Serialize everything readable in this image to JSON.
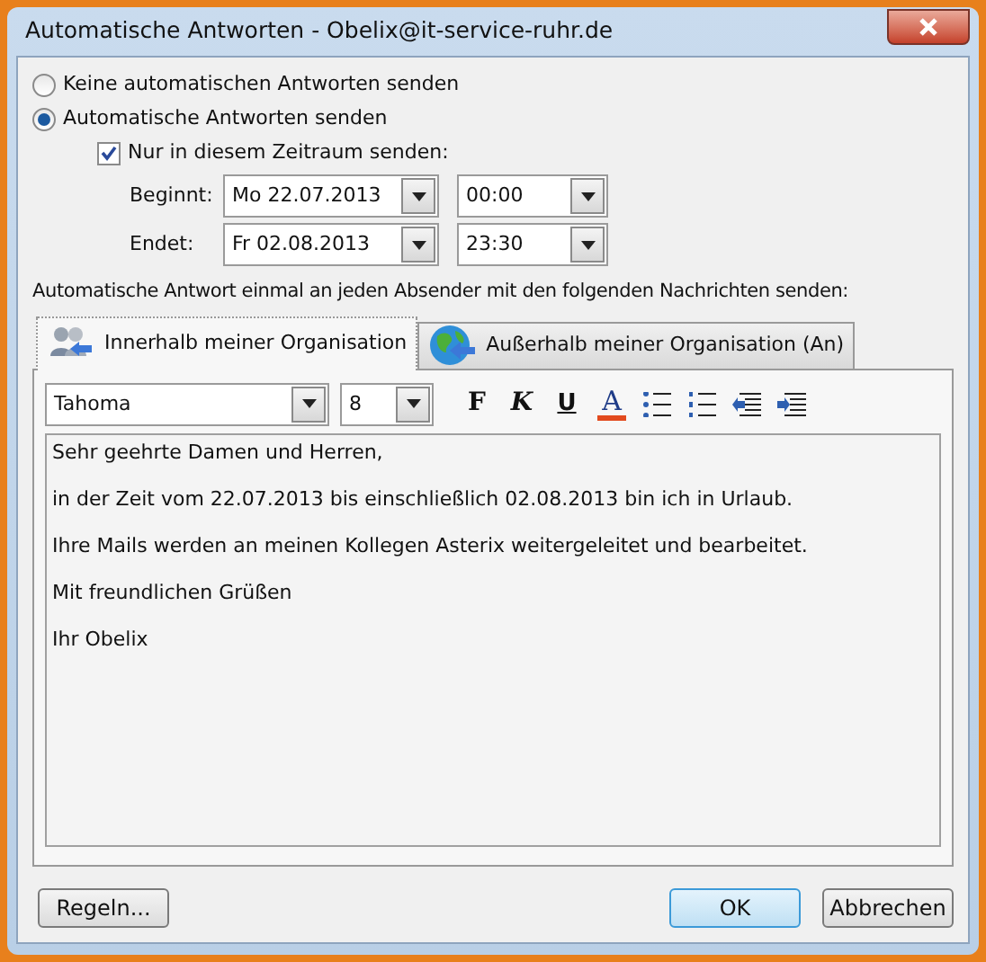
{
  "window": {
    "title": "Automatische Antworten - Obelix@it-service-ruhr.de"
  },
  "mode_options": [
    {
      "label": "Keine automatischen Antworten senden",
      "selected": false
    },
    {
      "label": "Automatische Antworten senden",
      "selected": true
    }
  ],
  "time_range": {
    "label": "Nur in diesem Zeitraum senden:",
    "checked": true,
    "rows": [
      {
        "label": "Beginnt:",
        "date": "Mo 22.07.2013",
        "time": "00:00"
      },
      {
        "label": "Endet:",
        "date": "Fr 02.08.2013",
        "time": "23:30"
      }
    ]
  },
  "instruction": "Automatische Antwort einmal an jeden Absender mit den folgenden Nachrichten senden:",
  "tabs": [
    {
      "label": "Innerhalb meiner Organisation",
      "selected": true,
      "kind": "people"
    },
    {
      "label": "Außerhalb meiner Organisation (An)",
      "selected": false,
      "kind": "globe"
    }
  ],
  "editor": {
    "font": "Tahoma",
    "size": "8",
    "format_buttons": [
      {
        "kind": "bold",
        "label": "F"
      },
      {
        "kind": "italic",
        "label": "K"
      },
      {
        "kind": "underline",
        "label": "U"
      },
      {
        "kind": "color",
        "label": "A"
      },
      {
        "kind": "bullets"
      },
      {
        "kind": "numbering"
      },
      {
        "kind": "outdent"
      },
      {
        "kind": "indent"
      }
    ],
    "blocks": [
      [
        "Sehr geehrte Damen und Herren,",
        "in der Zeit vom 22.07.2013 bis einschließlich 02.08.2013 bin ich in Urlaub.",
        "Ihre Mails werden an meinen Kollegen Asterix weitergeleitet und bearbeitet."
      ],
      [
        "Mit freundlichen Grüßen",
        "Ihr Obelix"
      ]
    ]
  },
  "buttons": [
    {
      "label": "Regeln...",
      "kind": "left"
    },
    {
      "label": "OK",
      "kind": "default"
    },
    {
      "label": "Abbrechen",
      "kind": "normal"
    }
  ]
}
